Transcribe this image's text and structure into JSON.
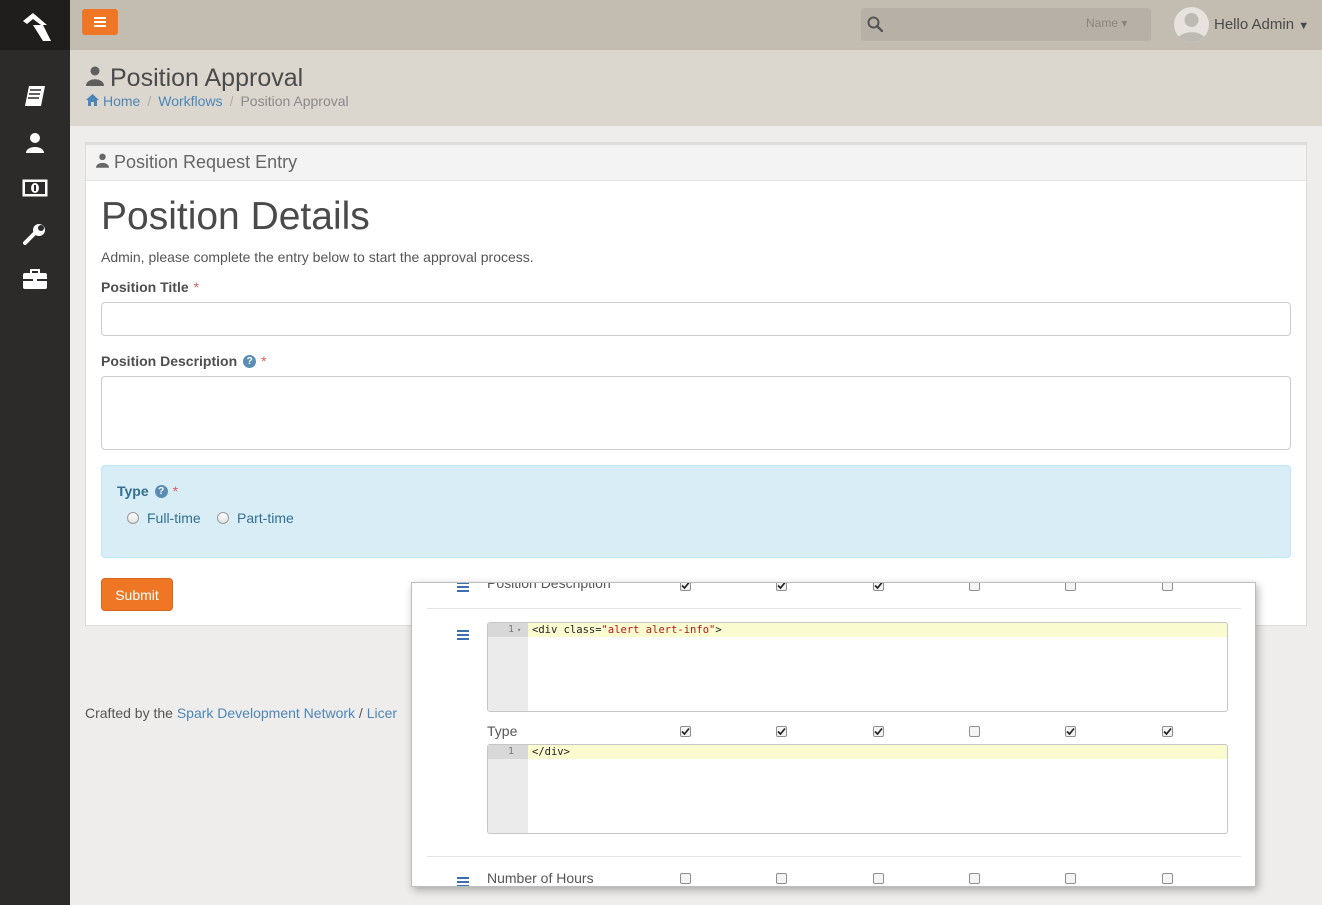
{
  "topbar": {
    "search": {
      "placeholder": "",
      "filter_label": "Name"
    },
    "user_greeting": "Hello Admin"
  },
  "page": {
    "title": "Position Approval",
    "breadcrumb": [
      {
        "label": "Home"
      },
      {
        "label": "Workflows"
      },
      {
        "label": "Position Approval"
      }
    ]
  },
  "panel": {
    "heading": "Position Request Entry",
    "form_title": "Position Details",
    "intro": "Admin, please complete the entry below to start the approval process.",
    "fields": {
      "position_title": {
        "label": "Position Title",
        "required": "*",
        "value": ""
      },
      "position_description": {
        "label": "Position Description",
        "required": "*",
        "help": "?",
        "value": ""
      },
      "type": {
        "label": "Type",
        "required": "*",
        "help": "?",
        "options": [
          "Full-time",
          "Part-time"
        ],
        "selected": null
      }
    },
    "submit_label": "Submit"
  },
  "footer": {
    "prefix": "Crafted by the ",
    "link": "Spark Development Network",
    "separator": " / ",
    "license_partial": "Licer"
  },
  "overlay": {
    "rows": [
      {
        "label": "Position Description",
        "checks": [
          true,
          true,
          true,
          false,
          false,
          false
        ]
      },
      {
        "label": "Type",
        "checks": [
          true,
          true,
          true,
          false,
          true,
          true
        ]
      },
      {
        "label": "Number of Hours",
        "checks": [
          false,
          false,
          false,
          false,
          false,
          false
        ]
      }
    ],
    "pre_editor": {
      "line_number": "1",
      "code_tag": "<div class=",
      "code_string": "\"alert alert-info\"",
      "code_end": ">"
    },
    "post_editor": {
      "line_number": "1",
      "code": "</div>"
    }
  },
  "colors": {
    "accent": "#ee7625",
    "topbar": "#c3bcb1",
    "sidebar": "#2d2b2a",
    "link": "#4c86b8",
    "alert_bg": "#d9edf7"
  },
  "icons": {
    "sidebar": [
      "book-icon",
      "user-icon",
      "money-icon",
      "wrench-icon",
      "briefcase-icon"
    ]
  }
}
